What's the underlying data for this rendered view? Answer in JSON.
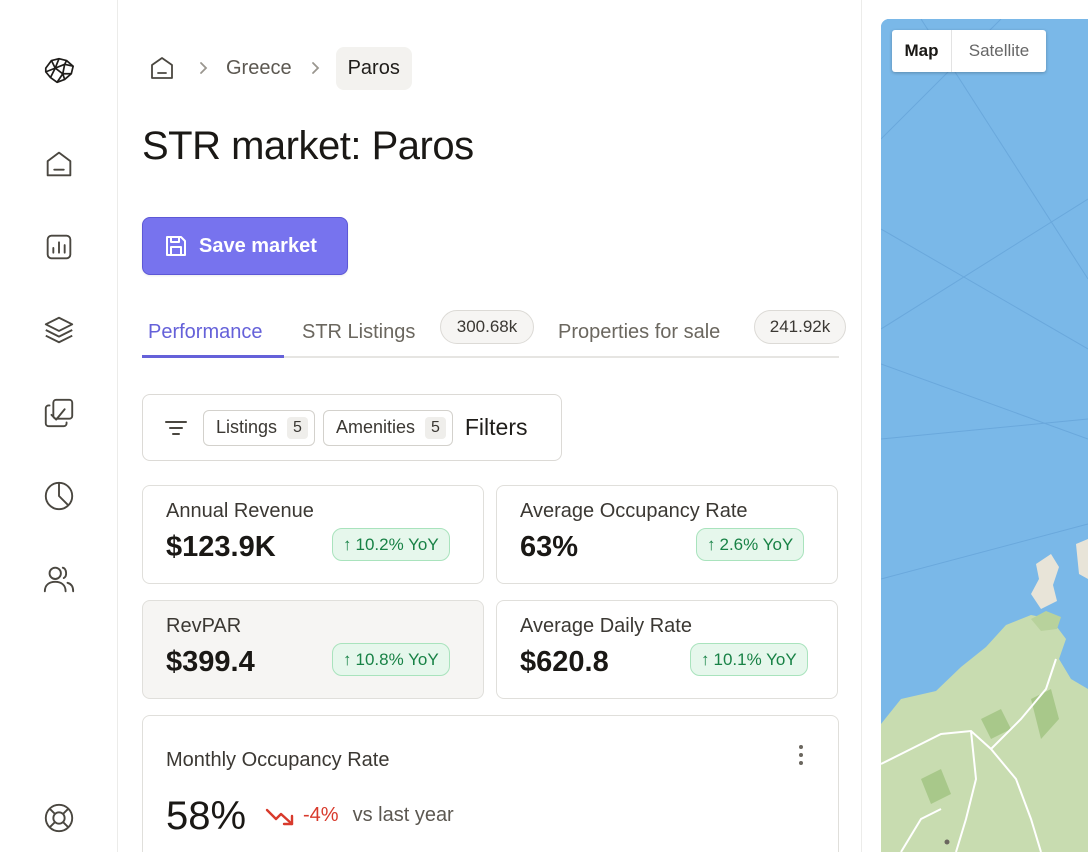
{
  "breadcrumb": {
    "items": [
      "Greece"
    ],
    "current": "Paros"
  },
  "page_title": "STR market: Paros",
  "save_button": "Save market",
  "tabs": [
    {
      "label": "Performance",
      "active": true
    },
    {
      "label": "STR Listings",
      "count": "300.68k"
    },
    {
      "label": "Properties for sale",
      "count": "241.92k"
    }
  ],
  "filters": {
    "chips": [
      {
        "label": "Listings",
        "count": "5"
      },
      {
        "label": "Amenities",
        "count": "5"
      }
    ],
    "label": "Filters"
  },
  "metrics": [
    {
      "label": "Annual Revenue",
      "value": "$123.9K",
      "yoy": "10.2% YoY"
    },
    {
      "label": "Average Occupancy Rate",
      "value": "63%",
      "yoy": "2.6% YoY"
    },
    {
      "label": "RevPAR",
      "value": "$399.4",
      "yoy": "10.8% YoY"
    },
    {
      "label": "Average Daily Rate",
      "value": "$620.8",
      "yoy": "10.1% YoY"
    }
  ],
  "monthly": {
    "title": "Monthly Occupancy Rate",
    "value": "58%",
    "delta": "-4%",
    "comparison": "vs last year"
  },
  "map": {
    "toggle": [
      "Map",
      "Satellite"
    ],
    "active": "Map"
  },
  "colors": {
    "accent": "#7773ee",
    "positive": "#188246",
    "negative": "#d83a2c",
    "water": "#7ab8e8",
    "land": "#c8dcb0"
  },
  "icons": {
    "sidebar": [
      "brain-logo-icon",
      "home-icon",
      "bar-chart-icon",
      "layers-icon",
      "checklist-icon",
      "pie-chart-icon",
      "users-icon",
      "lifebuoy-icon"
    ]
  }
}
